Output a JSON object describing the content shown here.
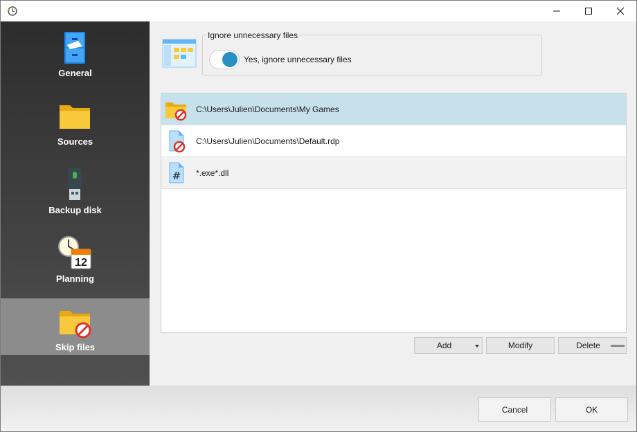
{
  "window": {
    "controls": {
      "minimize_icon": "minimize-icon",
      "maximize_icon": "maximize-icon",
      "close_icon": "close-icon"
    }
  },
  "sidebar": {
    "items": [
      {
        "label": "General",
        "icon": "filing-cabinet-icon",
        "active": false
      },
      {
        "label": "Sources",
        "icon": "folder-icon",
        "active": false
      },
      {
        "label": "Backup disk",
        "icon": "usb-drive-icon",
        "active": false
      },
      {
        "label": "Planning",
        "icon": "clock-calendar-icon",
        "active": false
      },
      {
        "label": "Skip files",
        "icon": "folder-blocked-icon",
        "active": true
      }
    ]
  },
  "ignore_group": {
    "title": "Ignore unnecessary files",
    "toggle_label": "Yes, ignore unnecessary files",
    "toggle_on": true
  },
  "skip_list": {
    "rows": [
      {
        "text": "C:\\Users\\Julien\\Documents\\My Games",
        "icon": "folder-blocked-icon",
        "selected": true
      },
      {
        "text": "C:\\Users\\Julien\\Documents\\Default.rdp",
        "icon": "file-blocked-icon",
        "selected": false
      },
      {
        "text": "*.exe*.dll",
        "icon": "hash-file-icon",
        "selected": false
      }
    ]
  },
  "list_buttons": {
    "add": "Add",
    "modify": "Modify",
    "delete": "Delete"
  },
  "footer": {
    "cancel": "Cancel",
    "ok": "OK"
  },
  "colors": {
    "accent": "#2a8fc3",
    "selected_row": "#c6e0ec",
    "sidebar_active": "#8c8c8c",
    "folder": "#f5c542",
    "block": "#d9342b"
  }
}
